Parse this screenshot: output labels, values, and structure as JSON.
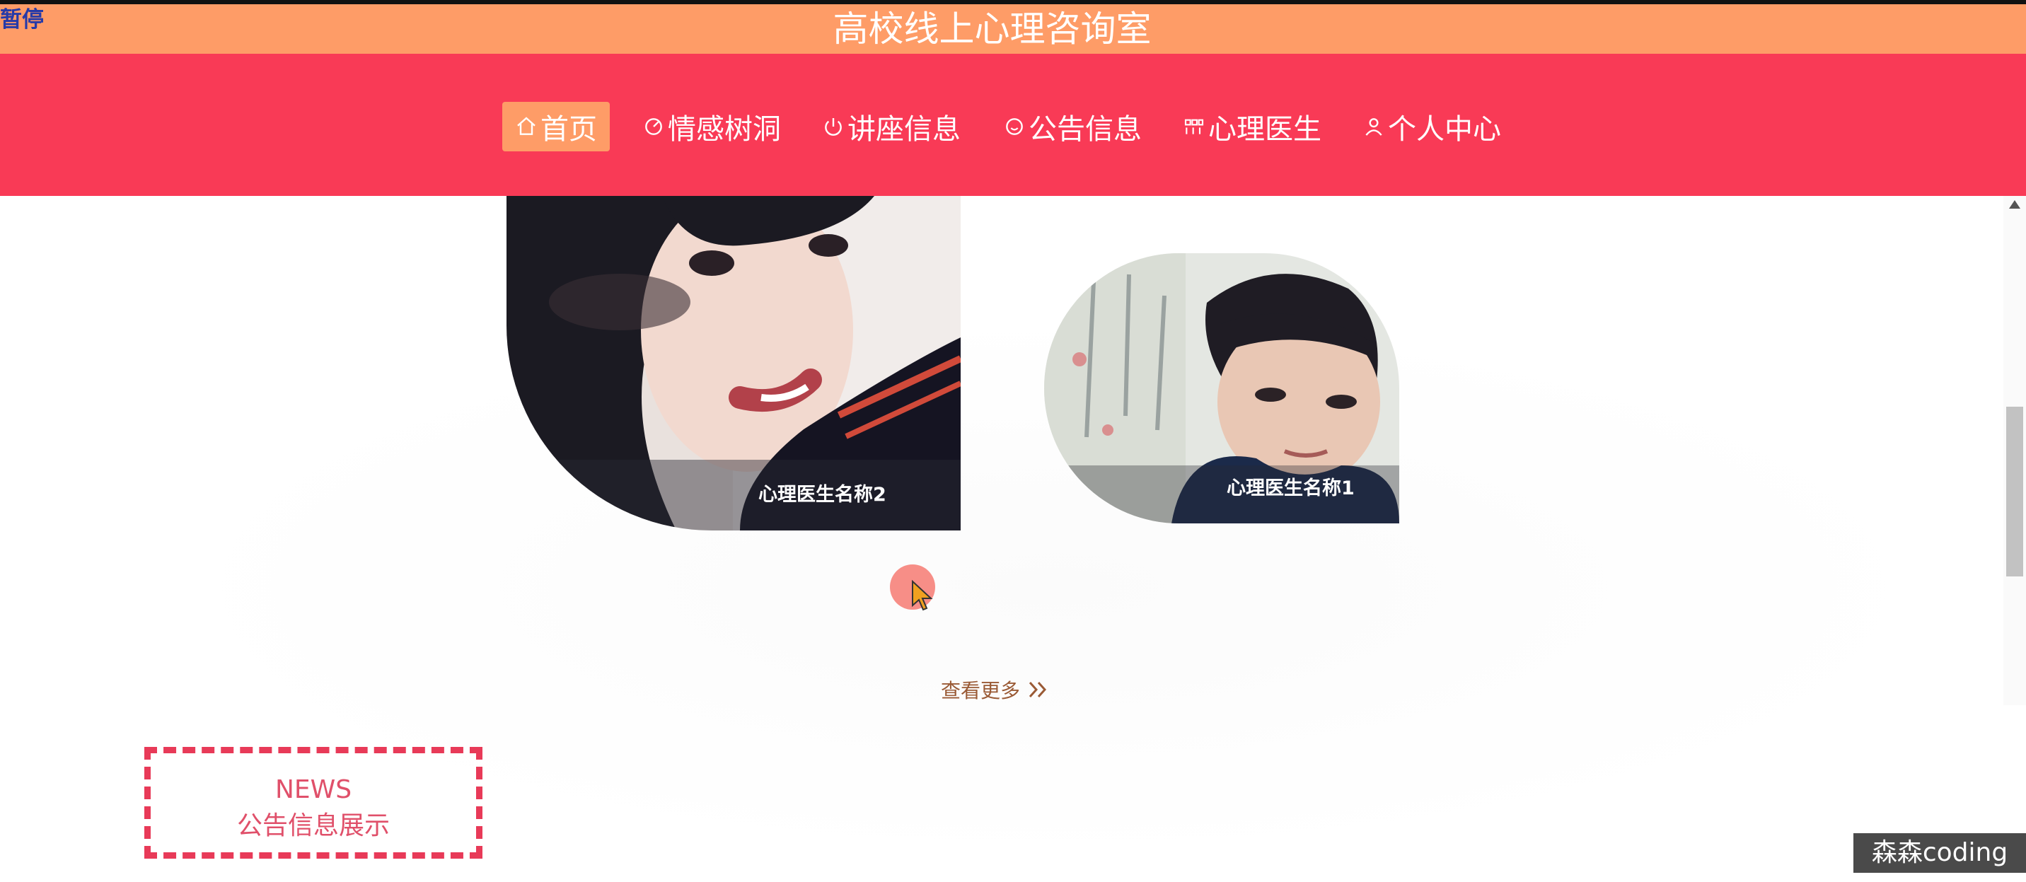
{
  "overlay": {
    "pause_text": "暂停",
    "watermark": "森森coding"
  },
  "header": {
    "site_title": "高校线上心理咨询室"
  },
  "nav": {
    "items": [
      {
        "label": "首页",
        "icon": "home-icon",
        "active": true
      },
      {
        "label": "情感树洞",
        "icon": "gauge-icon",
        "active": false
      },
      {
        "label": "讲座信息",
        "icon": "power-icon",
        "active": false
      },
      {
        "label": "公告信息",
        "icon": "smile-icon",
        "active": false
      },
      {
        "label": "心理医生",
        "icon": "grid-icon",
        "active": false
      },
      {
        "label": "个人中心",
        "icon": "user-icon",
        "active": false
      }
    ]
  },
  "doctors": {
    "cards": [
      {
        "name": "心理医生名称2",
        "icon": "doctor-photo-female"
      },
      {
        "name": "心理医生名称1",
        "icon": "doctor-photo-male"
      }
    ],
    "more_label": "查看更多"
  },
  "news": {
    "title_en": "NEWS",
    "title_cn": "公告信息展示"
  },
  "colors": {
    "title_bar": "#fe9c67",
    "nav_bar": "#f93a56",
    "nav_active": "#fe9c67",
    "news_accent": "#e83a58",
    "more_link": "#9a5a35"
  }
}
